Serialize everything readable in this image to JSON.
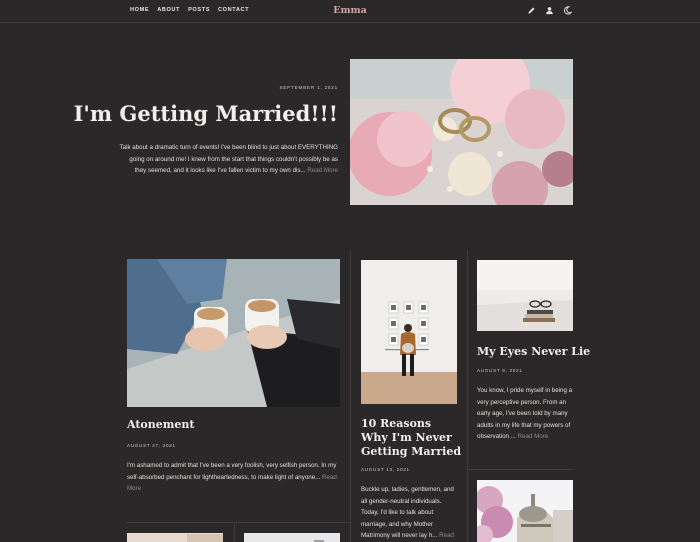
{
  "nav": {
    "items": [
      "HOME",
      "ABOUT",
      "POSTS",
      "CONTACT"
    ]
  },
  "brand": "Emma",
  "icons": [
    "pencil-icon",
    "user-icon",
    "moon-icon"
  ],
  "hero": {
    "date": "SEPTEMBER 1, 2021",
    "title": "I'm Getting Married!!!",
    "excerpt": "Talk about a dramatic turn of events! I've been blind to just about EVERYTHING going on around me! I knew from the start that things couldn't possibly be as they seemed, and it looks like I've fallen victim to my own dis...",
    "more": "Read More"
  },
  "posts": [
    {
      "title": "Atonement",
      "date": "AUGUST 27, 2021",
      "excerpt": "I'm ashamed to admit that I've been a very foolish, very selfish person. In my self-absorbed penchant for lightheartedness, to make light of anyone...",
      "more": "Read More"
    },
    {
      "title": "10 Reasons Why I'm Never Getting Married",
      "date": "AUGUST 13, 2021",
      "excerpt": "Buckle up, ladies, gentlemen, and all gender-neutral individuals. Today, I'd like to talk about marriage, and why Mother Matrimony will never lay h...",
      "more": "Read More"
    },
    {
      "title": "My Eyes Never Lie",
      "date": "AUGUST 9, 2021",
      "excerpt": "You know, I pride myself in being a very perceptive person. From an early age, I've been told by many adults in my life that my powers of observation ...",
      "more": "Read More"
    }
  ]
}
